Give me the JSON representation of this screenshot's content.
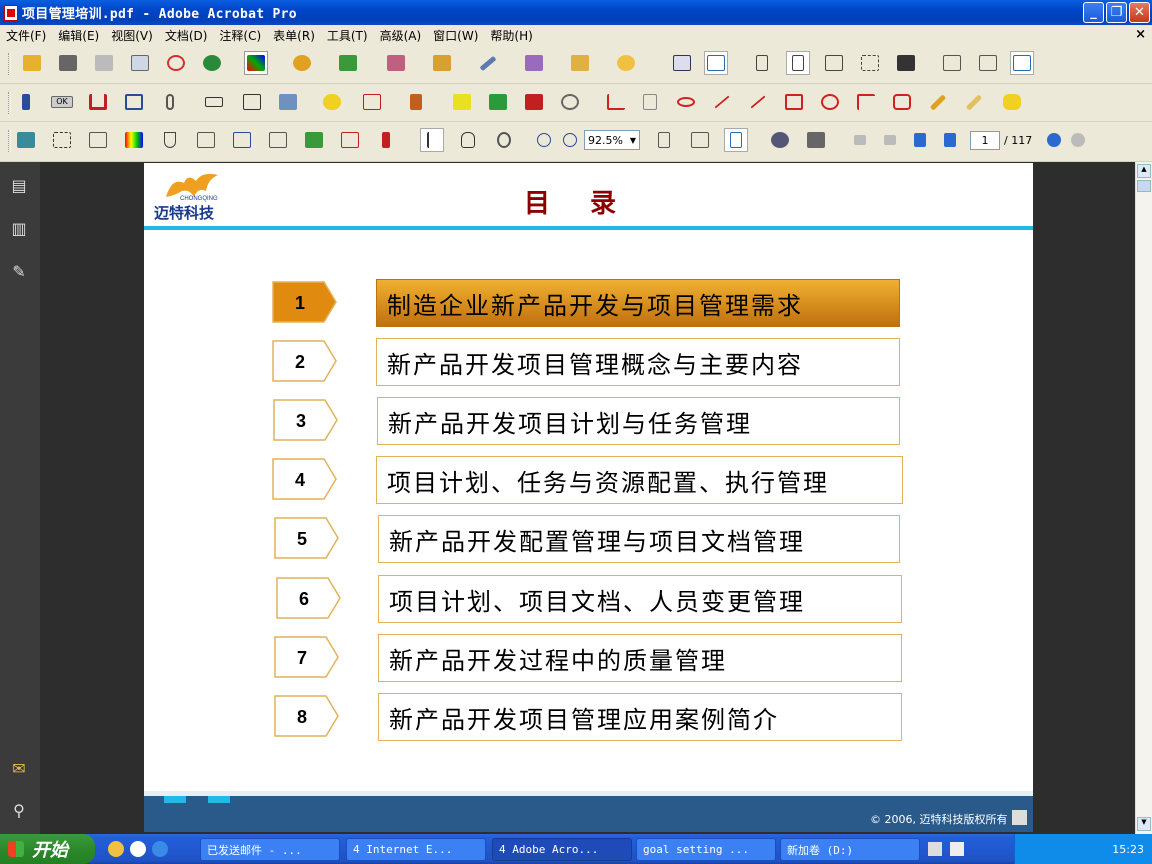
{
  "window": {
    "title": "项目管理培训.pdf - Adobe Acrobat Pro"
  },
  "menu": [
    "文件(F)",
    "编辑(E)",
    "视图(V)",
    "文档(D)",
    "注释(C)",
    "表单(R)",
    "工具(T)",
    "高级(A)",
    "窗口(W)",
    "帮助(H)"
  ],
  "toolbar": {
    "zoom": "92.5%",
    "page_current": "1",
    "page_total": "/ 117"
  },
  "slide": {
    "logo_brand": "CHONGQING",
    "logo_text": "迈特科技",
    "title": "目录",
    "items": [
      {
        "num": "1",
        "text": "制造企业新产品开发与项目管理需求"
      },
      {
        "num": "2",
        "text": "新产品开发项目管理概念与主要内容"
      },
      {
        "num": "3",
        "text": "新产品开发项目计划与任务管理"
      },
      {
        "num": "4",
        "text": "项目计划、任务与资源配置、执行管理"
      },
      {
        "num": "5",
        "text": "新产品开发配置管理与项目文档管理"
      },
      {
        "num": "6",
        "text": "项目计划、项目文档、人员变更管理"
      },
      {
        "num": "7",
        "text": "新产品开发过程中的质量管理"
      },
      {
        "num": "8",
        "text": "新产品开发项目管理应用案例简介"
      }
    ],
    "footer": "© 2006, 迈特科技版权所有"
  },
  "colors": {
    "active_item": "#e8a020",
    "item_border": "#e2b25a",
    "title": "#8b0000",
    "accent_line": "#22b8e8",
    "footer_band": "#2a5a8a"
  },
  "taskbar": {
    "start": "开始",
    "tasks": [
      "已发送邮件 - ...",
      "4 Internet E...",
      "4 Adobe Acro...",
      "goal setting ...",
      "新加卷 (D:)"
    ],
    "clock": "15:23"
  }
}
